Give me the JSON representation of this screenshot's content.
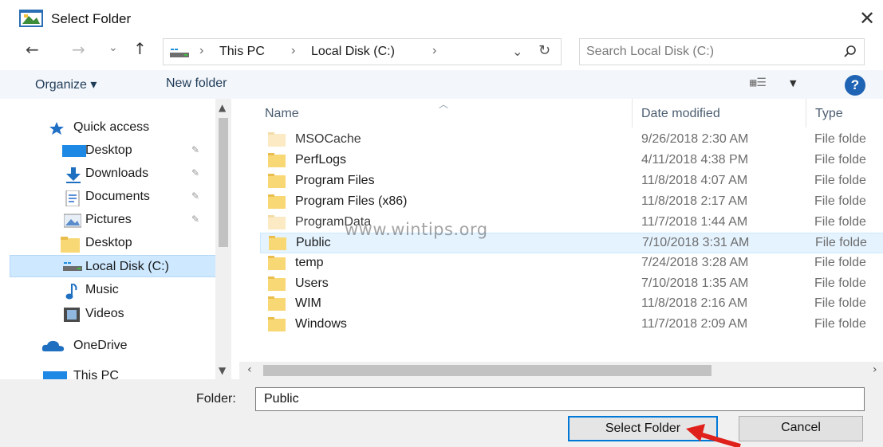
{
  "window": {
    "title": "Select Folder",
    "close_glyph": "✕"
  },
  "nav": {
    "back_glyph": "←",
    "forward_glyph": "→",
    "recent_glyph": "⌄",
    "up_glyph": "↑",
    "breadcrumb": [
      "This PC",
      "Local Disk (C:)"
    ],
    "separator": "›",
    "dropdown_glyph": "⌄",
    "refresh_glyph": "↻"
  },
  "search": {
    "placeholder": "Search Local Disk (C:)"
  },
  "toolbar": {
    "organize_label": "Organize ▾",
    "new_folder_label": "New folder",
    "view_glyph": "▦☰",
    "view_dropdown_glyph": "▼",
    "help_label": "?"
  },
  "sidebar": {
    "items": [
      {
        "label": "Quick access",
        "icon": "star-icon",
        "pinned": false
      },
      {
        "label": "Desktop",
        "icon": "desktop-icon",
        "pinned": true
      },
      {
        "label": "Downloads",
        "icon": "download-icon",
        "pinned": true
      },
      {
        "label": "Documents",
        "icon": "documents-icon",
        "pinned": true
      },
      {
        "label": "Pictures",
        "icon": "pictures-icon",
        "pinned": true
      },
      {
        "label": "Desktop",
        "icon": "folder-icon",
        "pinned": false
      },
      {
        "label": "Local Disk (C:)",
        "icon": "drive-icon",
        "pinned": false,
        "selected": true
      },
      {
        "label": "Music",
        "icon": "music-icon",
        "pinned": false
      },
      {
        "label": "Videos",
        "icon": "videos-icon",
        "pinned": false
      },
      {
        "label": "OneDrive",
        "icon": "cloud-icon",
        "pinned": false
      },
      {
        "label": "This PC",
        "icon": "computer-icon",
        "pinned": false
      }
    ],
    "pin_glyph": "✎"
  },
  "filelist": {
    "columns": [
      "Name",
      "Date modified",
      "Type"
    ],
    "rows": [
      {
        "name": "MSOCache",
        "date": "9/26/2018 2:30 AM",
        "type": "File folde",
        "faded": true
      },
      {
        "name": "PerfLogs",
        "date": "4/11/2018 4:38 PM",
        "type": "File folde"
      },
      {
        "name": "Program Files",
        "date": "11/8/2018 4:07 AM",
        "type": "File folde"
      },
      {
        "name": "Program Files (x86)",
        "date": "11/8/2018 2:17 AM",
        "type": "File folde"
      },
      {
        "name": "ProgramData",
        "date": "11/7/2018 1:44 AM",
        "type": "File folde",
        "faded": true
      },
      {
        "name": "Public",
        "date": "7/10/2018 3:31 AM",
        "type": "File folde",
        "selected": true
      },
      {
        "name": "temp",
        "date": "7/24/2018 3:28 AM",
        "type": "File folde"
      },
      {
        "name": "Users",
        "date": "7/10/2018 1:35 AM",
        "type": "File folde"
      },
      {
        "name": "WIM",
        "date": "11/8/2018 2:16 AM",
        "type": "File folde"
      },
      {
        "name": "Windows",
        "date": "11/7/2018 2:09 AM",
        "type": "File folde"
      }
    ]
  },
  "bottom": {
    "folder_label": "Folder:",
    "folder_value": "Public",
    "select_label": "Select Folder",
    "cancel_label": "Cancel"
  },
  "watermark": "www.wintips.org",
  "colors": {
    "accent": "#0078d7",
    "selection": "#cde8ff",
    "folder": "#f8d775",
    "annotation_arrow": "#e0201b"
  }
}
